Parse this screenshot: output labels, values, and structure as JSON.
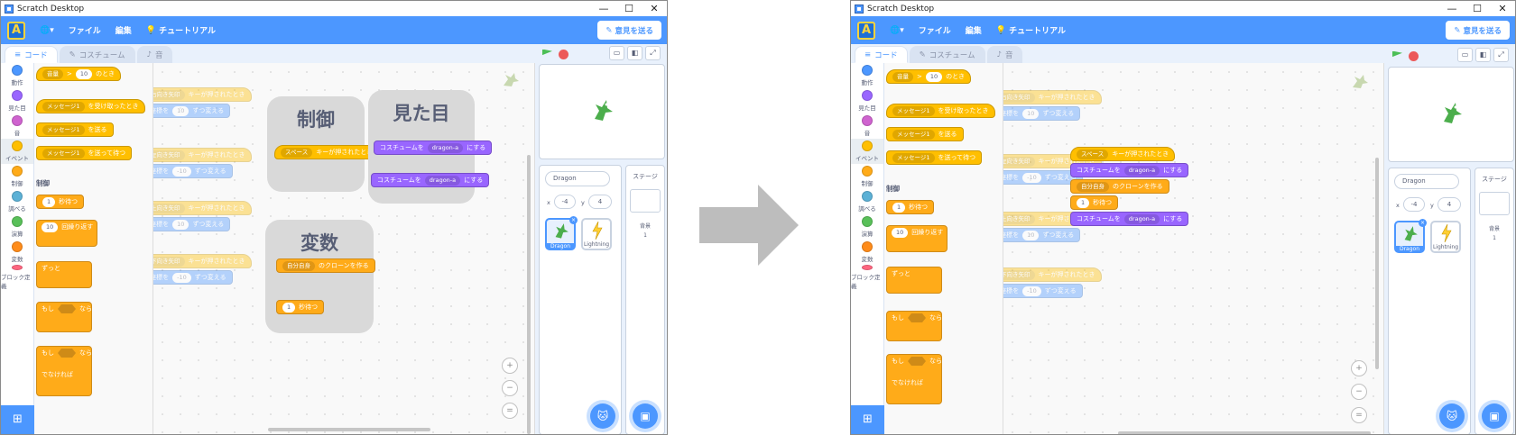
{
  "window": {
    "title": "Scratch Desktop",
    "min": "—",
    "max": "☐",
    "close": "✕"
  },
  "menu": {
    "logo": "A",
    "lang_icon": "🌐",
    "lang_caret": "▾",
    "file": "ファイル",
    "edit": "編集",
    "tutorial": "チュートリアル",
    "tutorial_icon": "💡",
    "feedback": "意見を送る",
    "feedback_icon": "✎"
  },
  "tabs": {
    "code": "コード",
    "costume": "コスチューム",
    "sound": "音"
  },
  "categories": [
    {
      "label": "動作",
      "color": "#4c97ff"
    },
    {
      "label": "見た目",
      "color": "#9966ff"
    },
    {
      "label": "音",
      "color": "#cf63cf"
    },
    {
      "label": "イベント",
      "color": "#ffbf00"
    },
    {
      "label": "制御",
      "color": "#ffab19"
    },
    {
      "label": "調べる",
      "color": "#5cb1d6"
    },
    {
      "label": "演算",
      "color": "#59c059"
    },
    {
      "label": "変数",
      "color": "#ff8c1a"
    },
    {
      "label": "ブロック定義",
      "color": "#ff6680"
    }
  ],
  "palette": {
    "loudness": "音量",
    "gt": ">",
    "ten": "10",
    "when": "のとき",
    "message1": "メッセージ1",
    "when_received": "を受け取ったとき",
    "broadcast": "を送る",
    "broadcast_wait": "を送って待つ",
    "control_header": "制御",
    "one": "1",
    "wait_secs": "秒待つ",
    "repeat": "回繰り返す",
    "forever": "ずっと",
    "if": "もし",
    "then": "なら",
    "else": "でなければ"
  },
  "ghost_blocks": [
    {
      "key": "右向き矢印",
      "when_pressed": "キーが押されたとき",
      "change_x": "x座標を",
      "val": "10",
      "by": "ずつ変える"
    },
    {
      "key": "左向き矢印",
      "when_pressed": "キーが押されたとき",
      "change_x": "x座標を",
      "val": "-10",
      "by": "ずつ変える"
    },
    {
      "key": "上向き矢印",
      "when_pressed": "キーが押されたとき",
      "change_y": "y座標を",
      "val": "10",
      "by": "ずつ変える"
    },
    {
      "key": "下向き矢印",
      "when_pressed": "キーが押されたとき",
      "change_y": "y座標を",
      "val": "-10",
      "by": "ずつ変える"
    }
  ],
  "notes": {
    "control": {
      "title": "制御",
      "key": "スペース",
      "when_pressed": "キーが押されたとき"
    },
    "looks": {
      "title": "見た目",
      "switch_costume": "コスチュームを",
      "costume": "dragon-a",
      "to": "にする"
    },
    "variables": {
      "title": "変数",
      "myself": "自分自身",
      "create_clone": "のクローンを作る",
      "one": "1",
      "wait_secs": "秒待つ"
    }
  },
  "assembled": {
    "key": "スペース",
    "when_pressed": "キーが押されたとき",
    "switch_costume": "コスチュームを",
    "costume": "dragon-a",
    "to": "にする",
    "myself": "自分自身",
    "create_clone": "のクローンを作る",
    "one": "1",
    "wait_secs": "秒待つ"
  },
  "sprite": {
    "name": "Dragon",
    "x_label": "x",
    "x": "-4",
    "y_label": "y",
    "y": "4"
  },
  "sprites": [
    {
      "name": "Dragon"
    },
    {
      "name": "Lightning"
    }
  ],
  "stage_panel": {
    "title": "ステージ",
    "backdrops_label": "背景",
    "backdrops_count": "1"
  },
  "zoom": {
    "in": "+",
    "out": "−",
    "reset": "="
  }
}
